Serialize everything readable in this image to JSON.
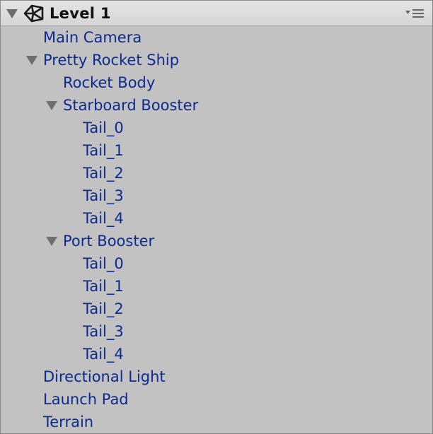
{
  "scene": {
    "title": "Level 1",
    "icon": "unity-logo-icon",
    "menu_icon": "options-menu-icon"
  },
  "hierarchy": [
    {
      "label": "Main Camera",
      "level": 1,
      "expanded": null
    },
    {
      "label": "Pretty Rocket Ship",
      "level": 1,
      "expanded": true
    },
    {
      "label": "Rocket Body",
      "level": 2,
      "expanded": null
    },
    {
      "label": "Starboard Booster",
      "level": 2,
      "expanded": true
    },
    {
      "label": "Tail_0",
      "level": 3,
      "expanded": null
    },
    {
      "label": "Tail_1",
      "level": 3,
      "expanded": null
    },
    {
      "label": "Tail_2",
      "level": 3,
      "expanded": null
    },
    {
      "label": "Tail_3",
      "level": 3,
      "expanded": null
    },
    {
      "label": "Tail_4",
      "level": 3,
      "expanded": null
    },
    {
      "label": "Port Booster",
      "level": 2,
      "expanded": true
    },
    {
      "label": "Tail_0",
      "level": 3,
      "expanded": null
    },
    {
      "label": "Tail_1",
      "level": 3,
      "expanded": null
    },
    {
      "label": "Tail_2",
      "level": 3,
      "expanded": null
    },
    {
      "label": "Tail_3",
      "level": 3,
      "expanded": null
    },
    {
      "label": "Tail_4",
      "level": 3,
      "expanded": null
    },
    {
      "label": "Directional Light",
      "level": 1,
      "expanded": null
    },
    {
      "label": "Launch Pad",
      "level": 1,
      "expanded": null
    },
    {
      "label": "Terrain",
      "level": 1,
      "expanded": null
    }
  ],
  "colors": {
    "item_text": "#0b2a93",
    "panel_bg": "#c2c2c2",
    "header_bg": "#dedede"
  }
}
